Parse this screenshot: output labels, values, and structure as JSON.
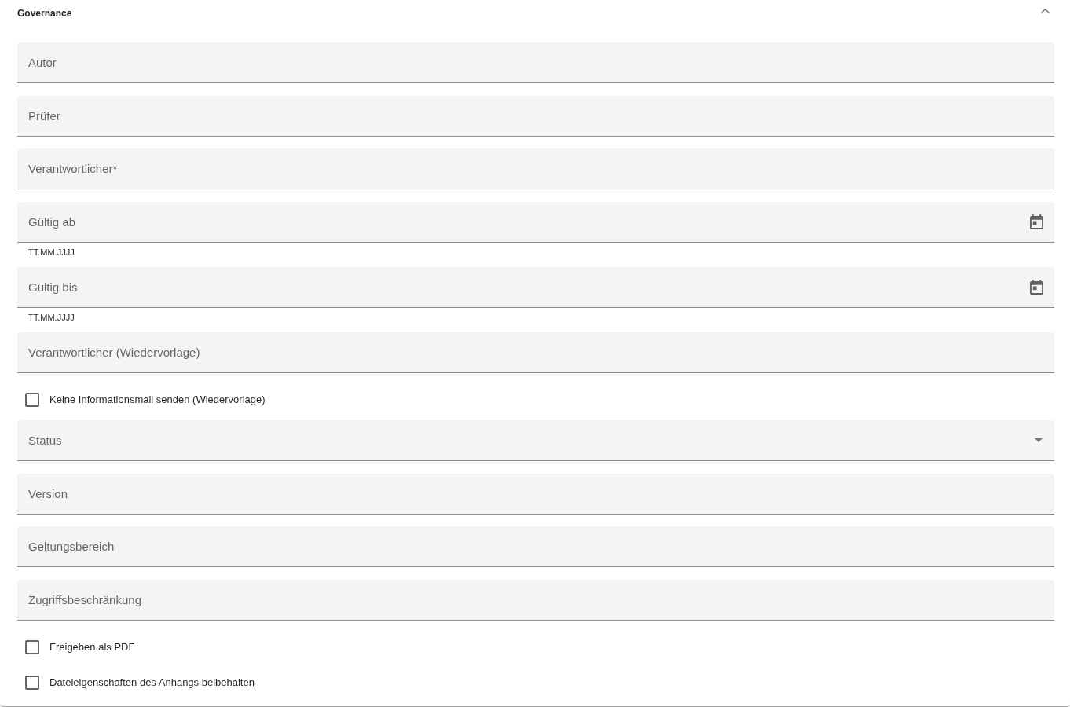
{
  "panel": {
    "title": "Governance",
    "expanded": true
  },
  "fields": [
    {
      "kind": "text",
      "placeholder": "Autor"
    },
    {
      "kind": "text",
      "placeholder": "Prüfer"
    },
    {
      "kind": "text",
      "placeholder": "Verantwortlicher*"
    },
    {
      "kind": "date",
      "placeholder": "Gültig ab",
      "helper_text": "TT.MM.JJJJ"
    },
    {
      "kind": "date",
      "placeholder": "Gültig bis",
      "helper_text": "TT.MM.JJJJ"
    },
    {
      "kind": "text",
      "placeholder": "Verantwortlicher (Wiedervorlage)"
    },
    {
      "kind": "checkbox",
      "label": "Keine Informationsmail senden (Wiedervorlage)",
      "checked": false
    },
    {
      "kind": "select",
      "placeholder": "Status"
    },
    {
      "kind": "text",
      "placeholder": "Version"
    },
    {
      "kind": "text",
      "placeholder": "Geltungsbereich"
    },
    {
      "kind": "text",
      "placeholder": "Zugriffsbeschränkung"
    },
    {
      "kind": "checkbox",
      "label": "Freigeben als PDF",
      "checked": false
    },
    {
      "kind": "checkbox",
      "label": "Dateieigenschaften des Anhangs beibehalten",
      "checked": false
    }
  ]
}
